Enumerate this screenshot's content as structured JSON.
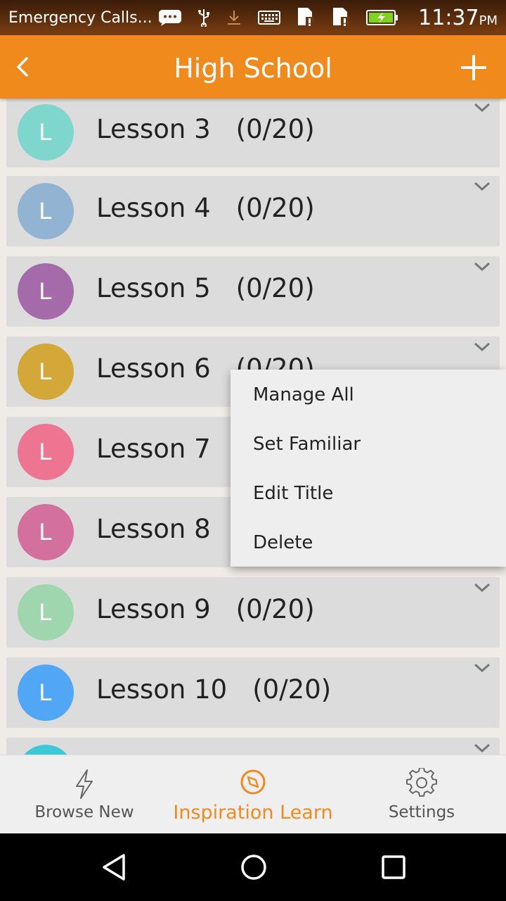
{
  "status_bar": {
    "carrier": "Emergency Calls...",
    "time": "11:37",
    "ampm": "PM",
    "icons": [
      "chat-icon",
      "usb-icon",
      "download-icon",
      "keyboard-icon",
      "sim-icon",
      "sim-icon",
      "battery-charging-icon"
    ]
  },
  "app_bar": {
    "title": "High School",
    "back_icon": "back-arrow-icon",
    "add_icon": "add-icon"
  },
  "lessons": [
    {
      "avatar": "L",
      "name": "Lesson 3",
      "count": "(0/20)",
      "color": "#7ed6cc"
    },
    {
      "avatar": "L",
      "name": "Lesson 4",
      "count": "(0/20)",
      "color": "#92b4d2"
    },
    {
      "avatar": "L",
      "name": "Lesson 5",
      "count": "(0/20)",
      "color": "#a56aaa"
    },
    {
      "avatar": "L",
      "name": "Lesson 6",
      "count": "(0/20)",
      "color": "#d4a838"
    },
    {
      "avatar": "L",
      "name": "Lesson 7",
      "count": "",
      "color": "#ee7592"
    },
    {
      "avatar": "L",
      "name": "Lesson 8",
      "count": "",
      "color": "#d4709e"
    },
    {
      "avatar": "L",
      "name": "Lesson 9",
      "count": "(0/20)",
      "color": "#a0d6ae"
    },
    {
      "avatar": "L",
      "name": "Lesson 10",
      "count": "(0/20)",
      "color": "#52a6f6"
    },
    {
      "avatar": "",
      "name": "",
      "count": "",
      "color": "#3cc8d8"
    }
  ],
  "popup_menu": {
    "items": [
      "Manage All",
      "Set Familiar",
      "Edit Title",
      "Delete"
    ]
  },
  "bottom_nav": {
    "items": [
      {
        "label": "Browse New",
        "icon": "lightning-icon"
      },
      {
        "label": "Inspiration Learn",
        "icon": "compass-icon",
        "active": true
      },
      {
        "label": "Settings",
        "icon": "gear-icon"
      }
    ]
  },
  "colors": {
    "accent": "#f08a1c",
    "row_bg": "#dcdcdc",
    "page_bg": "#efebe6"
  }
}
